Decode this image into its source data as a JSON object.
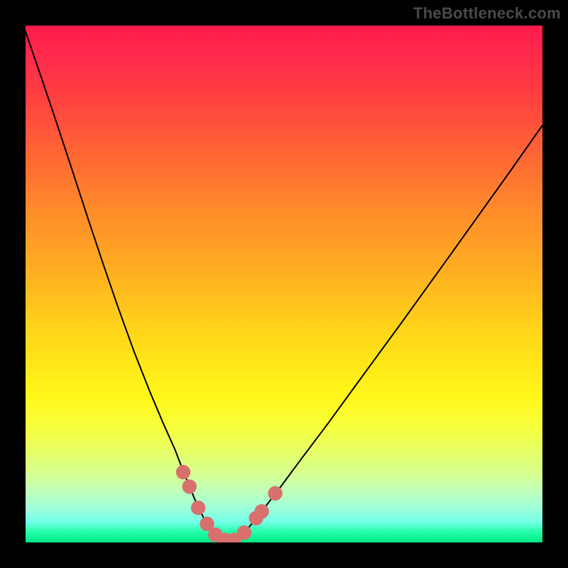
{
  "watermark": {
    "text": "TheBottleneck.com"
  },
  "colors": {
    "curve_stroke": "#000000",
    "bead_fill": "#d8706e",
    "bead_stroke": "#d8706e",
    "background_black": "#000000"
  },
  "chart_data": {
    "type": "line",
    "title": "",
    "xlabel": "",
    "ylabel": "",
    "xlim": [
      0,
      100
    ],
    "ylim": [
      0,
      100
    ],
    "note": "V-shaped bottleneck curve. Axis values are fractional positions (no tick labels visible). bottleneck_pct is the approximate vertical distance from the top (0 = top/red, 100 = bottom/green).",
    "series": [
      {
        "name": "left-branch",
        "x": [
          -3,
          0,
          3,
          6,
          9,
          12,
          15,
          18,
          21,
          24,
          26.7,
          28.9,
          30.6,
          32.1,
          33.3,
          34.5,
          35.5,
          36.4
        ],
        "bottleneck_pct": [
          -7,
          1.2,
          9.9,
          18.8,
          27.9,
          37.1,
          46.1,
          54.8,
          63.1,
          70.7,
          77.1,
          82.0,
          86.5,
          90.1,
          93.0,
          95.3,
          97.0,
          98.3
        ]
      },
      {
        "name": "floor",
        "x": [
          36.4,
          37.1,
          37.8,
          38.3,
          38.8,
          39.2,
          39.6,
          40.2,
          40.9,
          41.7
        ],
        "bottleneck_pct": [
          98.3,
          99.0,
          99.4,
          99.4,
          99.5,
          99.5,
          99.5,
          99.5,
          99.5,
          98.9
        ]
      },
      {
        "name": "right-branch",
        "x": [
          41.7,
          42.6,
          44.1,
          46.3,
          49.3,
          53.3,
          58.5,
          64.9,
          72.8,
          82.3,
          93.6,
          100.0
        ],
        "bottleneck_pct": [
          98.9,
          97.8,
          96.0,
          93.2,
          89.3,
          83.9,
          77.0,
          68.2,
          57.4,
          44.2,
          28.4,
          19.3
        ]
      }
    ],
    "beads": {
      "name": "highlight-points",
      "points": [
        {
          "x": 30.5,
          "bottleneck_pct": 86.4,
          "r": 1.4
        },
        {
          "x": 31.7,
          "bottleneck_pct": 89.2,
          "r": 1.4
        },
        {
          "x": 33.4,
          "bottleneck_pct": 93.3,
          "r": 1.4
        },
        {
          "x": 35.1,
          "bottleneck_pct": 96.4,
          "r": 1.4
        },
        {
          "x": 36.7,
          "bottleneck_pct": 98.5,
          "r": 1.4
        },
        {
          "x": 38.5,
          "bottleneck_pct": 99.5,
          "r": 1.4
        },
        {
          "x": 40.3,
          "bottleneck_pct": 99.5,
          "r": 1.4
        },
        {
          "x": 42.3,
          "bottleneck_pct": 98.1,
          "r": 1.4
        },
        {
          "x": 44.6,
          "bottleneck_pct": 95.3,
          "r": 1.4
        },
        {
          "x": 45.7,
          "bottleneck_pct": 94.0,
          "r": 1.4
        },
        {
          "x": 48.3,
          "bottleneck_pct": 90.5,
          "r": 1.4
        }
      ]
    }
  }
}
